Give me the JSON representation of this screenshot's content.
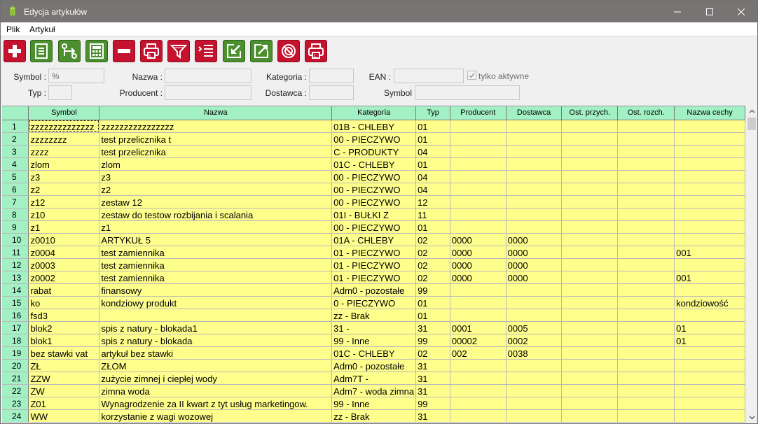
{
  "window": {
    "title": "Edycja artykułów"
  },
  "menu": [
    {
      "label": "Plik",
      "name": "menu-plik"
    },
    {
      "label": "Artykuł",
      "name": "menu-artykul"
    }
  ],
  "toolbar": [
    {
      "name": "add-button",
      "icon": "plus-icon",
      "color": "red"
    },
    {
      "name": "edit-button",
      "icon": "document-lines-icon",
      "color": "green"
    },
    {
      "name": "swap-button",
      "icon": "swap-arrows-icon",
      "color": "green"
    },
    {
      "name": "calculator-button",
      "icon": "calculator-icon",
      "color": "green"
    },
    {
      "name": "delete-button",
      "icon": "minus-icon",
      "color": "red"
    },
    {
      "name": "print-button",
      "icon": "printer-icon",
      "color": "red"
    },
    {
      "name": "filter-button",
      "icon": "funnel-icon",
      "color": "red"
    },
    {
      "name": "sort-button",
      "icon": "list-sort-icon",
      "color": "red"
    },
    {
      "name": "import-button",
      "icon": "import-icon",
      "color": "green"
    },
    {
      "name": "export-button",
      "icon": "export-icon",
      "color": "green"
    },
    {
      "name": "disable-button",
      "icon": "disabled-icon",
      "color": "red"
    },
    {
      "name": "print-label-button",
      "icon": "printer-label-icon",
      "color": "red"
    }
  ],
  "filters": {
    "symbol_label": "Symbol :",
    "symbol_value": "%",
    "nazwa_label": "Nazwa :",
    "nazwa_value": "",
    "kategoria_label": "Kategoria :",
    "kategoria_value": "",
    "ean_label": "EAN :",
    "ean_value": "",
    "tylko_aktywne_label": "tylko aktywne",
    "typ_label": "Typ :",
    "typ_value": "",
    "producent_label": "Producent :",
    "producent_value": "",
    "dostawca_label": "Dostawca :",
    "dostawca_value": "",
    "symbol2_label": "Symbol",
    "symbol2_value": ""
  },
  "table": {
    "columns": [
      "Symbol",
      "Nazwa",
      "Kategoria",
      "Typ",
      "Producent",
      "Dostawca",
      "Ost. przych.",
      "Ost. rozch.",
      "Nazwa cechy"
    ],
    "rows": [
      [
        "1",
        "zzzzzzzzzzzzzz",
        "zzzzzzzzzzzzzzzz",
        "01B - CHLEBY",
        "01",
        "",
        "",
        "",
        "",
        ""
      ],
      [
        "2",
        "zzzzzzzz",
        "test przelicznika t",
        "00 - PIECZYWO",
        "01",
        "",
        "",
        "",
        "",
        ""
      ],
      [
        "3",
        "zzzz",
        "test przelicznika",
        "C - PRODUKTY",
        "04",
        "",
        "",
        "",
        "",
        ""
      ],
      [
        "4",
        "zlom",
        "zlom",
        "01C - CHLEBY",
        "01",
        "",
        "",
        "",
        "",
        ""
      ],
      [
        "5",
        "z3",
        "z3",
        "00 - PIECZYWO",
        "04",
        "",
        "",
        "",
        "",
        ""
      ],
      [
        "6",
        "z2",
        "z2",
        "00 - PIECZYWO",
        "04",
        "",
        "",
        "",
        "",
        ""
      ],
      [
        "7",
        "z12",
        "zestaw 12",
        "00 - PIECZYWO",
        "12",
        "",
        "",
        "",
        "",
        ""
      ],
      [
        "8",
        "z10",
        "zestaw do testow rozbijania i scalania",
        "01I - BUŁKI Z",
        "11",
        "",
        "",
        "",
        "",
        ""
      ],
      [
        "9",
        "z1",
        "z1",
        "00 - PIECZYWO",
        "01",
        "",
        "",
        "",
        "",
        ""
      ],
      [
        "10",
        "z0010",
        "ARTYKUŁ 5",
        "01A - CHLEBY",
        "02",
        "0000",
        "0000",
        "",
        "",
        ""
      ],
      [
        "11",
        "z0004",
        "test zamiennika",
        "01 - PIECZYWO",
        "02",
        "0000",
        "0000",
        "",
        "",
        "001"
      ],
      [
        "12",
        "z0003",
        "test zamiennika",
        "01 - PIECZYWO",
        "02",
        "0000",
        "0000",
        "",
        "",
        ""
      ],
      [
        "13",
        "z0002",
        "test zamiennika",
        "01 - PIECZYWO",
        "02",
        "0000",
        "0000",
        "",
        "",
        "001"
      ],
      [
        "14",
        "rabat",
        "finansowy",
        "Adm0 - pozostałe",
        "99",
        "",
        "",
        "",
        "",
        ""
      ],
      [
        "15",
        "ko",
        "kondziowy produkt",
        "0 - PIECZYWO",
        "01",
        "",
        "",
        "",
        "",
        "kondziowość"
      ],
      [
        "16",
        "fsd3",
        "",
        "zz - Brak",
        "01",
        "",
        "",
        "",
        "",
        ""
      ],
      [
        "17",
        "blok2",
        "spis z natury - blokada1",
        "31 -",
        "31",
        "0001",
        "0005",
        "",
        "",
        "01"
      ],
      [
        "18",
        "blok1",
        "spis z natury - blokada",
        "99 - Inne",
        "99",
        "00002",
        "0002",
        "",
        "",
        "01"
      ],
      [
        "19",
        "bez stawki vat",
        "artykuł bez stawki",
        "01C - CHLEBY",
        "02",
        "002",
        "0038",
        "",
        "",
        ""
      ],
      [
        "20",
        "ZŁ",
        "ZŁOM",
        "Adm0 - pozostałe",
        "31",
        "",
        "",
        "",
        "",
        ""
      ],
      [
        "21",
        "ZZW",
        "zużycie  zimnej i ciepłej wody",
        "Adm7T -",
        "31",
        "",
        "",
        "",
        "",
        ""
      ],
      [
        "22",
        "ZW",
        "zimna woda",
        "Adm7 - woda zimna",
        "31",
        "",
        "",
        "",
        "",
        ""
      ],
      [
        "23",
        "Z01",
        "Wynagrodzenie za II kwart z tyt usług marketingow.",
        "99 - Inne",
        "99",
        "",
        "",
        "",
        "",
        ""
      ],
      [
        "24",
        "WW",
        "korzystanie z wagi wozowej",
        "zz - Brak",
        "31",
        "",
        "",
        "",
        "",
        ""
      ]
    ]
  },
  "colors": {
    "header_bg": "#a3f0c4",
    "row_bg": "#fefe8c",
    "titlebar_bg": "#787473"
  }
}
